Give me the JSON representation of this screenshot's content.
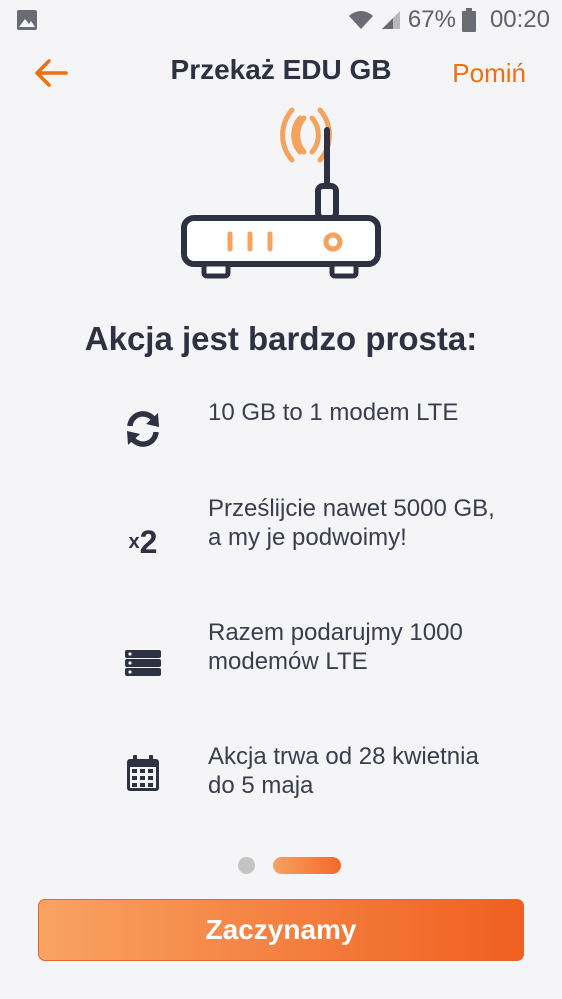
{
  "status_bar": {
    "battery": "67%",
    "time": "00:20"
  },
  "header": {
    "title": "Przekaż EDU GB",
    "skip_label": "Pomiń"
  },
  "headline": "Akcja jest bardzo prosta:",
  "features": [
    {
      "icon": "refresh-icon",
      "text": "10 GB to 1 modem LTE"
    },
    {
      "icon": "x2-icon",
      "icon_text_prefix": "x",
      "icon_text_main": "2",
      "text": "Prześlijcie nawet 5000 GB, a my je podwoimy!"
    },
    {
      "icon": "server-icon",
      "text": "Razem podarujmy 1000 modemów LTE"
    },
    {
      "icon": "calendar-icon",
      "text": "Akcja trwa od 28 kwietnia do 5 maja"
    }
  ],
  "pager": {
    "pages": 2,
    "current": 2
  },
  "cta_label": "Zaczynamy",
  "colors": {
    "accent": "#ee6f10",
    "text": "#2d3142",
    "background": "#f5f5f7"
  }
}
